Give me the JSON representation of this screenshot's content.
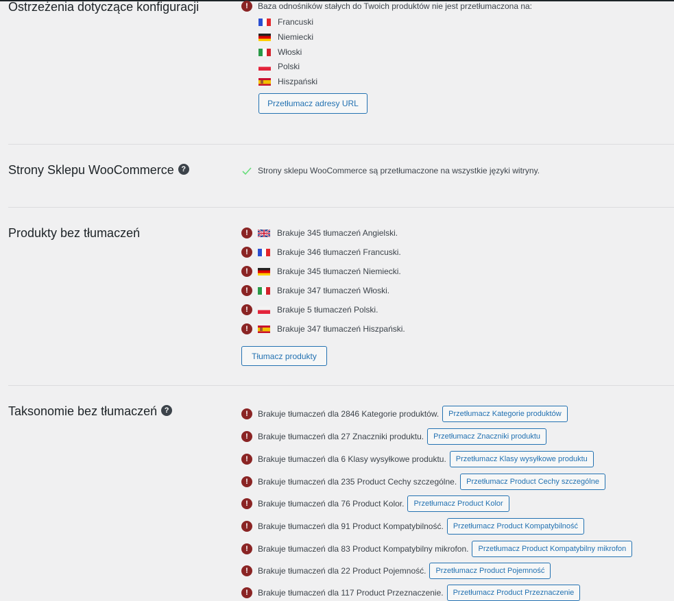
{
  "config_warnings": {
    "title": "Ostrzeżenia dotyczące konfiguracji",
    "message": "Baza odnośników stałych do Twoich produktów nie jest przetłumaczona na:",
    "languages": [
      {
        "flag": "fr",
        "name": "Francuski"
      },
      {
        "flag": "de",
        "name": "Niemiecki"
      },
      {
        "flag": "it",
        "name": "Włoski"
      },
      {
        "flag": "pl",
        "name": "Polski"
      },
      {
        "flag": "es",
        "name": "Hiszpański"
      }
    ],
    "button": "Przetłumacz adresy URL"
  },
  "shop_pages": {
    "title": "Strony Sklepu WooCommerce",
    "message": "Strony sklepu WooCommerce są przetłumaczone na wszystkie języki witryny."
  },
  "products": {
    "title": "Produkty bez tłumaczeń",
    "items": [
      {
        "flag": "gb",
        "text": "Brakuje 345 tłumaczeń Angielski."
      },
      {
        "flag": "fr",
        "text": "Brakuje 346 tłumaczeń Francuski."
      },
      {
        "flag": "de",
        "text": "Brakuje 345 tłumaczeń Niemiecki."
      },
      {
        "flag": "it",
        "text": "Brakuje 347 tłumaczeń Włoski."
      },
      {
        "flag": "pl",
        "text": "Brakuje 5 tłumaczeń Polski."
      },
      {
        "flag": "es",
        "text": "Brakuje 347 tłumaczeń Hiszpański."
      }
    ],
    "button": "Tłumacz produkty"
  },
  "taxonomies": {
    "title": "Taksonomie bez tłumaczeń",
    "items": [
      {
        "text": "Brakuje tłumaczeń dla 2846 Kategorie produktów.",
        "button": "Przetłumacz Kategorie produktów"
      },
      {
        "text": "Brakuje tłumaczeń dla 27 Znaczniki produktu.",
        "button": "Przetłumacz Znaczniki produktu"
      },
      {
        "text": "Brakuje tłumaczeń dla 6 Klasy wysyłkowe produktu.",
        "button": "Przetłumacz Klasy wysyłkowe produktu"
      },
      {
        "text": "Brakuje tłumaczeń dla 235 Product Cechy szczególne.",
        "button": "Przetłumacz Product Cechy szczególne"
      },
      {
        "text": "Brakuje tłumaczeń dla 76 Product Kolor.",
        "button": "Przetłumacz Product Kolor"
      },
      {
        "text": "Brakuje tłumaczeń dla 91 Product Kompatybilność.",
        "button": "Przetłumacz Product Kompatybilność"
      },
      {
        "text": "Brakuje tłumaczeń dla 83 Product Kompatybilny mikrofon.",
        "button": "Przetłumacz Product Kompatybilny mikrofon"
      },
      {
        "text": "Brakuje tłumaczeń dla 22 Product Pojemność.",
        "button": "Przetłumacz Product Pojemność"
      },
      {
        "text": "Brakuje tłumaczeń dla 117 Product Przeznaczenie.",
        "button": "Przetłumacz Product Przeznaczenie"
      }
    ]
  },
  "colors": {
    "error": "#8a2424",
    "ok": "#68de7c",
    "link": "#2271b1",
    "background": "#f0f0f1"
  },
  "icons": {
    "error": "exclamation-circle-icon",
    "ok": "checkmark-icon",
    "help": "question-circle-icon"
  }
}
